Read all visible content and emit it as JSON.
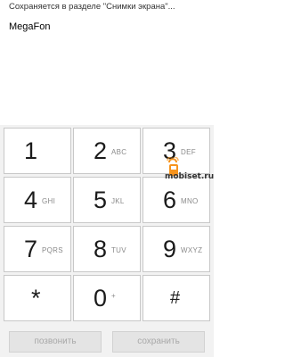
{
  "status_text": "Сохраняется в разделе \"Снимки экрана\"...",
  "operator": "MegaFon",
  "keys": [
    {
      "digit": "1",
      "letters": ""
    },
    {
      "digit": "2",
      "letters": "ABC"
    },
    {
      "digit": "3",
      "letters": "DEF"
    },
    {
      "digit": "4",
      "letters": "GHI"
    },
    {
      "digit": "5",
      "letters": "JKL"
    },
    {
      "digit": "6",
      "letters": "MNO"
    },
    {
      "digit": "7",
      "letters": "PQRS"
    },
    {
      "digit": "8",
      "letters": "TUV"
    },
    {
      "digit": "9",
      "letters": "WXYZ"
    },
    {
      "digit": "*",
      "letters": ""
    },
    {
      "digit": "0",
      "letters": "+"
    },
    {
      "digit": "#",
      "letters": ""
    }
  ],
  "actions": {
    "call": "позвонить",
    "save": "сохранить"
  },
  "watermark": "mobiset.ru",
  "colors": {
    "keypad_background": "#f2f2f2",
    "key_background": "#ffffff",
    "disabled_text": "#a8a8a8",
    "watermark_accent": "#f7941d"
  }
}
